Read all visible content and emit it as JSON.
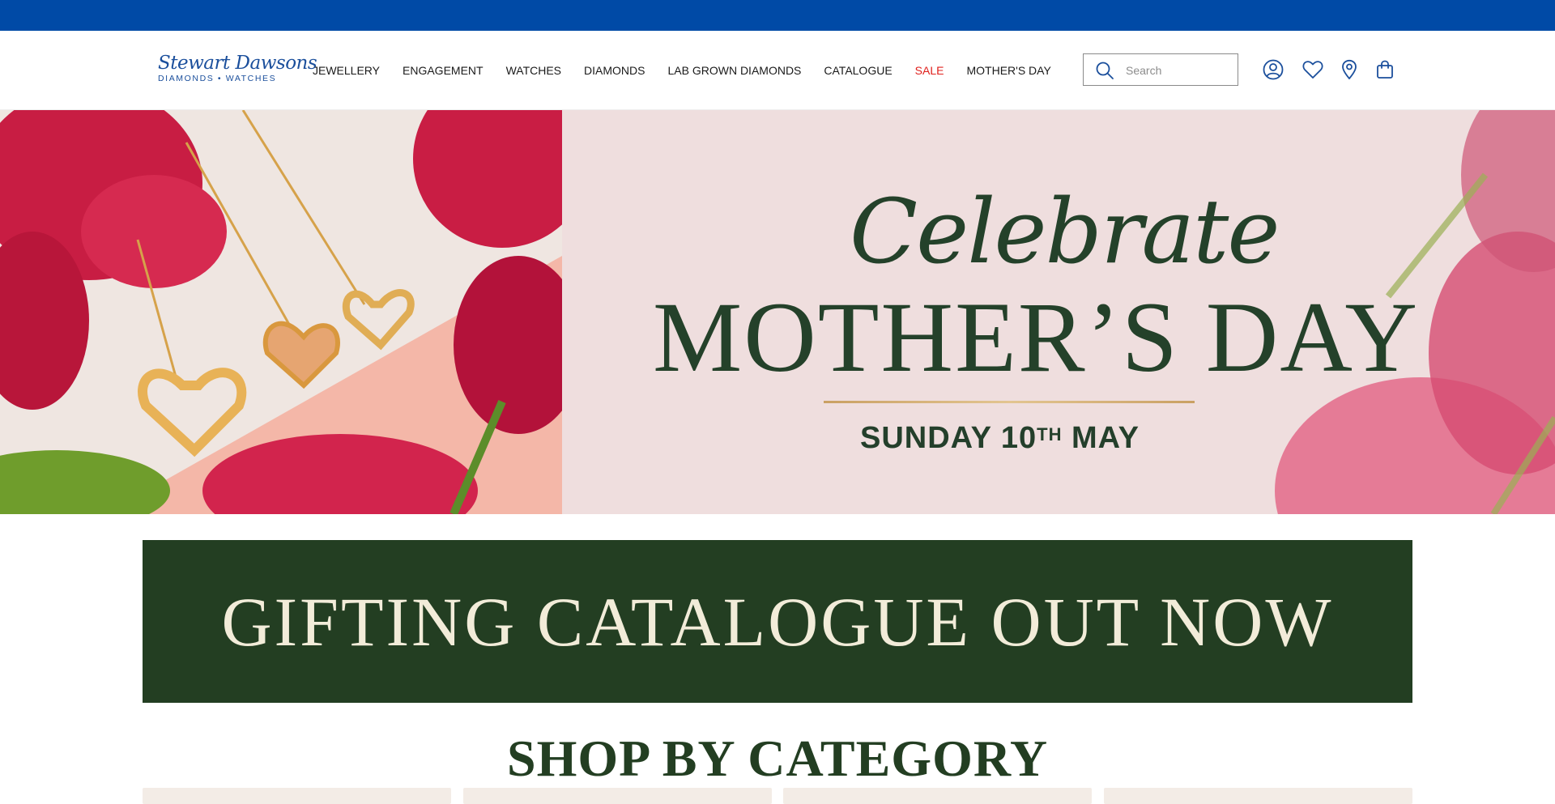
{
  "brand": {
    "name": "Stewart Dawsons",
    "tagline": "DIAMONDS • WATCHES",
    "color": "#1b4f9c",
    "top_strip_color": "#004aa6"
  },
  "nav": {
    "items": [
      {
        "label": "JEWELLERY"
      },
      {
        "label": "ENGAGEMENT"
      },
      {
        "label": "WATCHES"
      },
      {
        "label": "DIAMONDS"
      },
      {
        "label": "LAB GROWN DIAMONDS"
      },
      {
        "label": "CATALOGUE"
      },
      {
        "label": "SALE",
        "color": "#e0201c"
      },
      {
        "label": "MOTHER'S DAY"
      }
    ]
  },
  "search": {
    "placeholder": "Search",
    "icon": "search-icon"
  },
  "header_icons": [
    "account-icon",
    "wishlist-heart-icon",
    "store-locator-pin-icon",
    "shopping-bag-icon"
  ],
  "hero": {
    "script": "Celebrate",
    "title": "MOTHER’S DAY",
    "date_prefix": "SUNDAY 10",
    "date_sup": "TH",
    "date_suffix": " MAY",
    "text_color": "#24412a",
    "accent": "#c9a063"
  },
  "banner": {
    "text": "GIFTING CATALOGUE OUT NOW",
    "bg": "#233e22",
    "fg": "#f2ecd9"
  },
  "category_section": {
    "heading": "SHOP BY CATEGORY"
  }
}
